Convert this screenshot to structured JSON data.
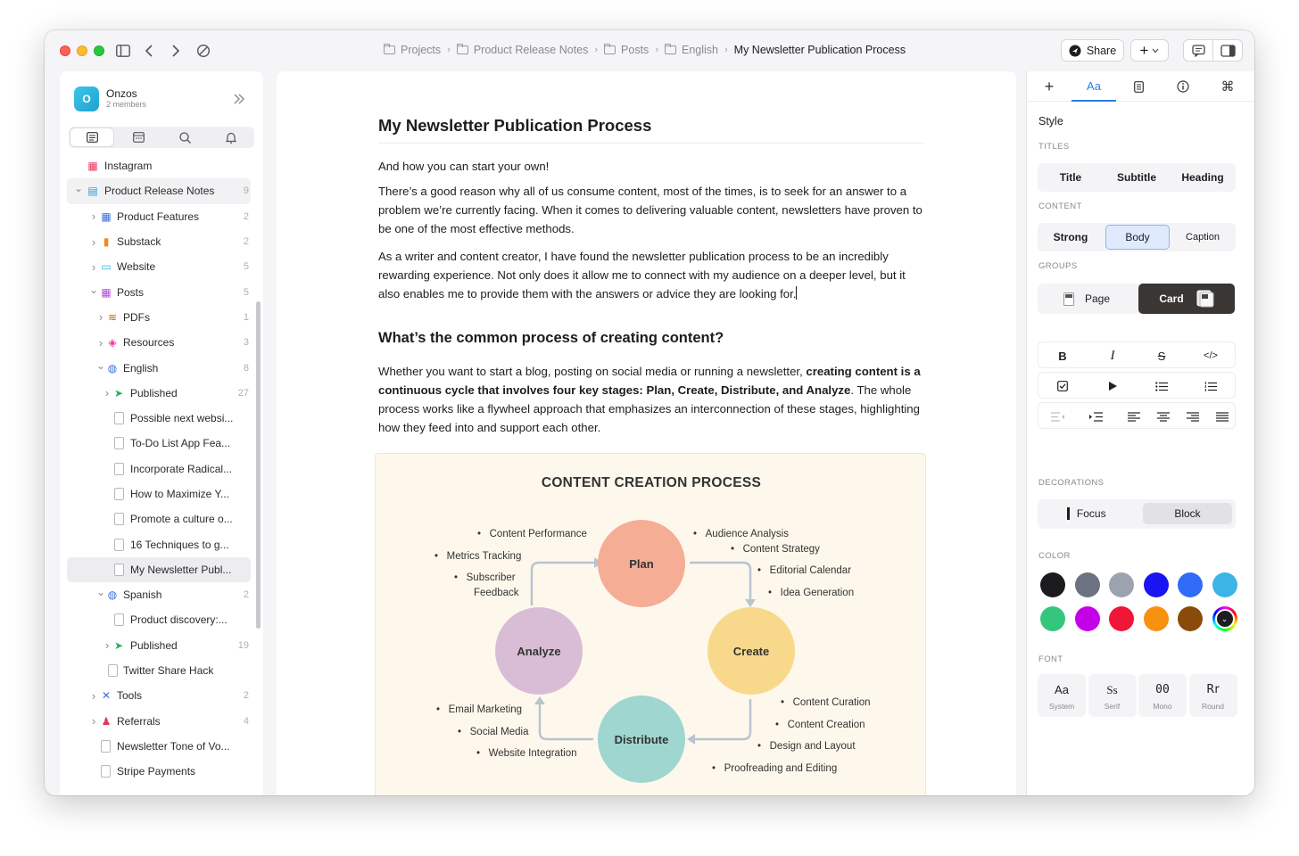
{
  "breadcrumb": [
    "Projects",
    "Product Release Notes",
    "Posts",
    "English",
    "My Newsletter Publication Process"
  ],
  "toolbar": {
    "share_label": "Share",
    "add_label": "+"
  },
  "workspace": {
    "initial": "O",
    "name": "Onzos",
    "members": "2 members"
  },
  "sidebar_tree": [
    {
      "label": "Instagram",
      "count": "",
      "indent": 0,
      "chevron": "",
      "icon": "instagram-icon",
      "color": "#e5355b",
      "glyph": "▦"
    },
    {
      "label": "Product Release Notes",
      "count": "9",
      "indent": 0,
      "chevron": "down",
      "icon": "notes-icon",
      "color": "#2a9bd8",
      "glyph": "▤",
      "sel": "bar"
    },
    {
      "label": "Product Features",
      "count": "2",
      "indent": 1,
      "chevron": "right",
      "icon": "calendar-icon",
      "color": "#3d6fe0",
      "glyph": "▦"
    },
    {
      "label": "Substack",
      "count": "2",
      "indent": 1,
      "chevron": "right",
      "icon": "bookmark-icon",
      "color": "#f08a1c",
      "glyph": "▮"
    },
    {
      "label": "Website",
      "count": "5",
      "indent": 1,
      "chevron": "right",
      "icon": "monitor-icon",
      "color": "#2ab3d6",
      "glyph": "▭"
    },
    {
      "label": "Posts",
      "count": "5",
      "indent": 1,
      "chevron": "down",
      "icon": "posts-icon",
      "color": "#b44fd6",
      "glyph": "▦"
    },
    {
      "label": "PDFs",
      "count": "1",
      "indent": 2,
      "chevron": "right",
      "icon": "stack-icon",
      "color": "#b5651d",
      "glyph": "≋"
    },
    {
      "label": "Resources",
      "count": "3",
      "indent": 2,
      "chevron": "right",
      "icon": "tags-icon",
      "color": "#e5398f",
      "glyph": "◈"
    },
    {
      "label": "English",
      "count": "8",
      "indent": 2,
      "chevron": "down",
      "icon": "globe-icon",
      "color": "#3d6fe0",
      "glyph": "◍"
    },
    {
      "label": "Published",
      "count": "27",
      "indent": 3,
      "chevron": "right",
      "icon": "send-icon",
      "color": "#27b35a",
      "glyph": "➤"
    },
    {
      "label": "Possible next websi...",
      "count": "",
      "indent": 4,
      "chevron": "",
      "icon": "doc-icon"
    },
    {
      "label": "To-Do List App Fea...",
      "count": "",
      "indent": 4,
      "chevron": "",
      "icon": "doc-icon"
    },
    {
      "label": "Incorporate Radical...",
      "count": "",
      "indent": 4,
      "chevron": "",
      "icon": "doc-icon"
    },
    {
      "label": "How to Maximize Y...",
      "count": "",
      "indent": 4,
      "chevron": "",
      "icon": "doc-icon"
    },
    {
      "label": "Promote a culture o...",
      "count": "",
      "indent": 4,
      "chevron": "",
      "icon": "doc-icon"
    },
    {
      "label": "16 Techniques to g...",
      "count": "",
      "indent": 4,
      "chevron": "",
      "icon": "doc-icon"
    },
    {
      "label": "My Newsletter Publ...",
      "count": "",
      "indent": 4,
      "chevron": "",
      "icon": "doc-icon",
      "sel": "active"
    },
    {
      "label": "Spanish",
      "count": "2",
      "indent": 2,
      "chevron": "down",
      "icon": "globe-icon",
      "color": "#3d6fe0",
      "glyph": "◍"
    },
    {
      "label": "Product discovery:...",
      "count": "",
      "indent": 4,
      "chevron": "",
      "icon": "doc-icon"
    },
    {
      "label": "Published",
      "count": "19",
      "indent": 3,
      "chevron": "right",
      "icon": "send-icon",
      "color": "#27b35a",
      "glyph": "➤"
    },
    {
      "label": "Twitter Share Hack",
      "count": "",
      "indent": 3,
      "chevron": "",
      "icon": "doc-icon"
    },
    {
      "label": "Tools",
      "count": "2",
      "indent": 1,
      "chevron": "right",
      "icon": "tools-icon",
      "color": "#3d6fe0",
      "glyph": "✕"
    },
    {
      "label": "Referrals",
      "count": "4",
      "indent": 1,
      "chevron": "right",
      "icon": "people-icon",
      "color": "#e5355b",
      "glyph": "♟"
    },
    {
      "label": "Newsletter Tone of Vo...",
      "count": "",
      "indent": 1,
      "chevron": "",
      "icon": "doc-icon"
    },
    {
      "label": "Stripe Payments",
      "count": "",
      "indent": 1,
      "chevron": "",
      "icon": "doc-icon"
    }
  ],
  "document": {
    "title": "My Newsletter Publication Process",
    "subtitle": "And how you can start your own!",
    "p1": "There’s a good reason why all of us consume content, most of the times, is to seek for an answer to a problem we’re currently facing. When it comes to delivering valuable content, newsletters have proven to be one of the most effective methods.",
    "p2": "As a writer and content creator, I have found the newsletter publication process to be an incredibly rewarding experience. Not only does it allow me to connect with my audience on a deeper level, but it also enables me to provide them with the answers or advice they are looking for.",
    "h2": "What’s the common process of creating content?",
    "p3_a": "Whether you want to start a blog, posting on social media or running a newsletter, ",
    "p3_bold": "creating content is a continuous cycle that involves four key stages: Plan, Create, Distribute, and Analyze",
    "p3_b": ". The whole process works like a flywheel approach that emphasizes an interconnection of these stages, highlighting how they feed into and support each other."
  },
  "figure": {
    "title": "CONTENT CREATION PROCESS",
    "stages": {
      "plan": "Plan",
      "create": "Create",
      "distribute": "Distribute",
      "analyze": "Analyze"
    },
    "plan_left": [
      "Content Performance",
      "Metrics Tracking",
      "Subscriber",
      "Feedback"
    ],
    "plan_right": [
      "Audience Analysis",
      "Content Strategy",
      "Editorial Calendar",
      "Idea Generation"
    ],
    "create_items": [
      "Content Curation",
      "Content Creation",
      "Design and Layout",
      "Proofreading and Editing"
    ],
    "distribute_items": [
      "Email Marketing",
      "Social Media",
      "Website Integration"
    ],
    "colors": {
      "plan": "#f5ad96",
      "create": "#f8d98c",
      "distribute": "#9fd6d0",
      "analyze": "#d9bcd6",
      "arrow": "#b8c4d0"
    }
  },
  "panel": {
    "section": "Style",
    "titles_label": "TITLES",
    "titles": [
      "Title",
      "Subtitle",
      "Heading"
    ],
    "content_label": "CONTENT",
    "content": [
      "Strong",
      "Body",
      "Caption"
    ],
    "groups_label": "GROUPS",
    "groups": [
      "Page",
      "Card"
    ],
    "decorations_label": "DECORATIONS",
    "decorations": [
      "Focus",
      "Block"
    ],
    "color_label": "COLOR",
    "colors": [
      "#1c1c1e",
      "#6b7280",
      "#9ca3af",
      "#1a14f2",
      "#2f6bf6",
      "#3cb4e6",
      "#34c77b",
      "#c400e8",
      "#ef1638",
      "#f8910f",
      "#8a4a0a"
    ],
    "font_label": "FONT",
    "fonts": [
      {
        "glyph": "Aa",
        "name": "System"
      },
      {
        "glyph": "Ss",
        "name": "Serif"
      },
      {
        "glyph": "00",
        "name": "Mono"
      },
      {
        "glyph": "Rr",
        "name": "Round"
      }
    ]
  }
}
